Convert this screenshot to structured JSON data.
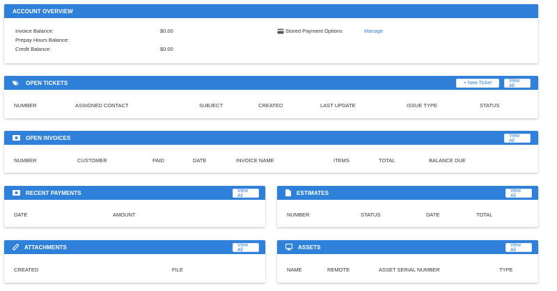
{
  "account_overview": {
    "title": "ACCOUNT OVERVIEW",
    "invoice_balance_label": "Invoice Balance:",
    "invoice_balance_value": "$0.00",
    "prepay_hours_label": "Prepay Hours Balance:",
    "credit_balance_label": "Credit Balance:",
    "credit_balance_value": "$0.00",
    "stored_payment_label": "Stored Payment Options",
    "manage_link": "Manage"
  },
  "open_tickets": {
    "title": "OPEN TICKETS",
    "new_ticket_label": "+ New Ticket",
    "view_all_label": "View All",
    "columns": [
      "NUMBER",
      "ASSIGNED CONTACT",
      "SUBJECT",
      "CREATED",
      "LAST UPDATE",
      "ISSUE TYPE",
      "STATUS"
    ]
  },
  "open_invoices": {
    "title": "OPEN INVOICES",
    "view_all_label": "View All",
    "columns": [
      "NUMBER",
      "CUSTOMER",
      "PAID",
      "DATE",
      "INVOICE NAME",
      "ITEMS",
      "TOTAL",
      "BALANCE DUE"
    ]
  },
  "recent_payments": {
    "title": "RECENT PAYMENTS",
    "view_all_label": "View All",
    "columns": [
      "DATE",
      "AMOUNT"
    ]
  },
  "estimates": {
    "title": "ESTIMATES",
    "view_all_label": "View All",
    "columns": [
      "NUMBER",
      "STATUS",
      "DATE",
      "TOTAL"
    ]
  },
  "attachments": {
    "title": "ATTACHMENTS",
    "view_all_label": "View All",
    "columns": [
      "CREATED",
      "FILE"
    ]
  },
  "assets": {
    "title": "ASSETS",
    "view_all_label": "View All",
    "columns": [
      "NAME",
      "REMOTE",
      "ASSET SERIAL NUMBER",
      "TYPE"
    ]
  },
  "colors": {
    "header_blue": "#2f80d9",
    "link_blue": "#2f80d9"
  }
}
